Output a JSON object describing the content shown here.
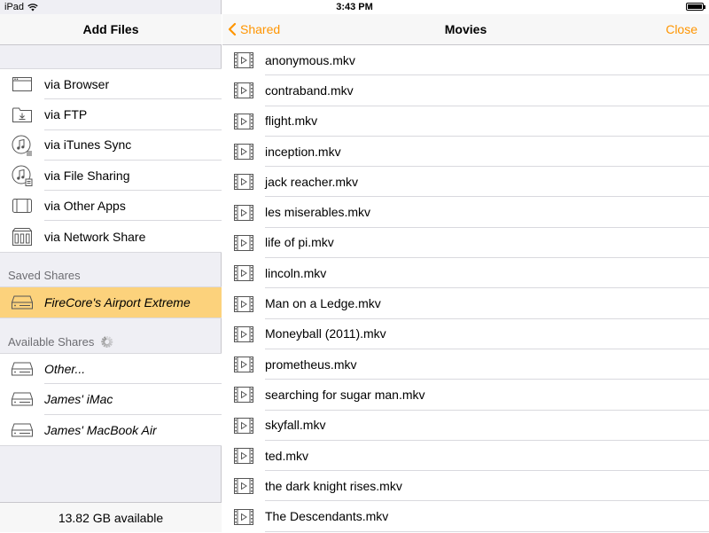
{
  "status_bar": {
    "device": "iPad",
    "time": "3:43 PM"
  },
  "left_panel": {
    "title": "Add Files",
    "add_options": [
      {
        "label": "via Browser",
        "icon": "browser-window-icon"
      },
      {
        "label": "via FTP",
        "icon": "ftp-folder-icon"
      },
      {
        "label": "via iTunes Sync",
        "icon": "itunes-sync-icon"
      },
      {
        "label": "via File Sharing",
        "icon": "file-sharing-icon"
      },
      {
        "label": "via Other Apps",
        "icon": "other-apps-icon"
      },
      {
        "label": "via Network Share",
        "icon": "network-share-icon"
      }
    ],
    "saved_shares_title": "Saved Shares",
    "saved_shares": [
      {
        "label": "FireCore's Airport Extreme",
        "selected": true
      }
    ],
    "available_shares_title": "Available Shares",
    "available_shares": [
      {
        "label": "Other..."
      },
      {
        "label": "James' iMac"
      },
      {
        "label": "James' MacBook Air"
      }
    ],
    "footer": "13.82 GB available"
  },
  "right_panel": {
    "back_label": "Shared",
    "title": "Movies",
    "close_label": "Close",
    "files": [
      "anonymous.mkv",
      "contraband.mkv",
      "flight.mkv",
      "inception.mkv",
      "jack reacher.mkv",
      "les miserables.mkv",
      "life of pi.mkv",
      "lincoln.mkv",
      "Man on a Ledge.mkv",
      "Moneyball (2011).mkv",
      "prometheus.mkv",
      "searching for sugar man.mkv",
      "skyfall.mkv",
      "ted.mkv",
      "the dark knight rises.mkv",
      "The Descendants.mkv"
    ]
  },
  "colors": {
    "accent": "#ff9500",
    "selected_row": "#fcd27c",
    "group_bg": "#efeff4"
  }
}
